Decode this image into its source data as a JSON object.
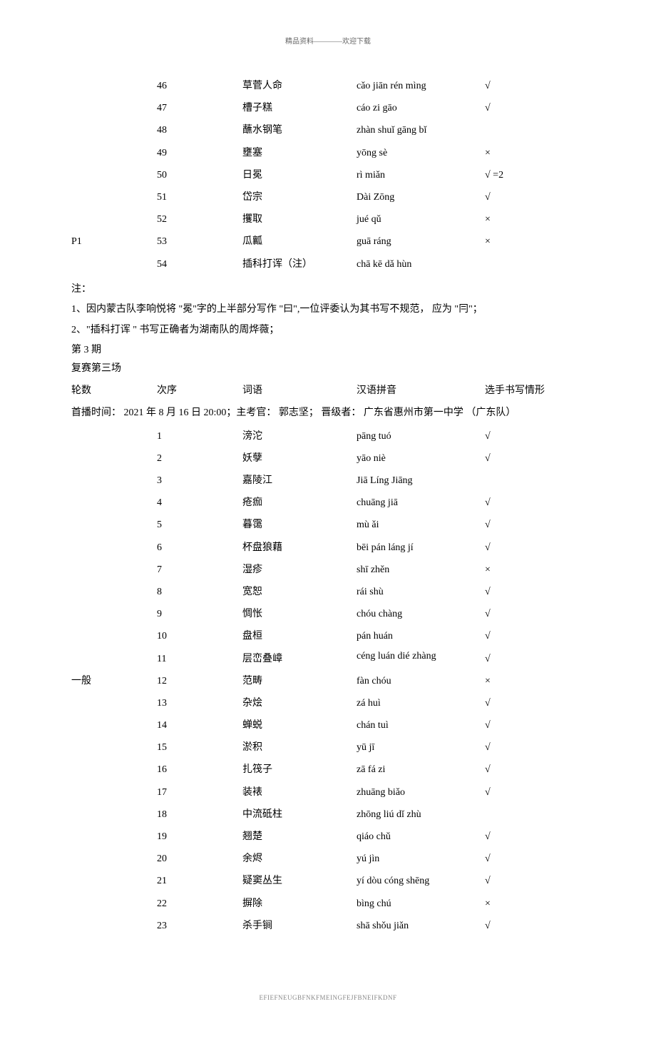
{
  "header_note": "精品资料————欢迎下载",
  "footer_code": "EFIEFNEUGBFNKFMEINGFEJFBNEIFKDNF",
  "table1": {
    "left_label": "P1",
    "rows": [
      {
        "n": "46",
        "word": "草菅人命",
        "pinyin": "cǎo jiān rén mìng",
        "result": "√"
      },
      {
        "n": "47",
        "word": "槽子糕",
        "pinyin": "cáo zi gāo",
        "result": "√"
      },
      {
        "n": "48",
        "word": "蘸水钢笔",
        "pinyin": "zhàn shuǐ gāng bǐ",
        "result": ""
      },
      {
        "n": "49",
        "word": "壅塞",
        "pinyin": "yōng sè",
        "result": "×"
      },
      {
        "n": "50",
        "word": "日冕",
        "pinyin": "rì miǎn",
        "result": "√ =2"
      },
      {
        "n": "51",
        "word": "岱宗",
        "pinyin": "Dài Zōng",
        "result": "√"
      },
      {
        "n": "52",
        "word": "攫取",
        "pinyin": "jué qǔ",
        "result": "×"
      },
      {
        "n": "53",
        "word": "瓜瓤",
        "pinyin": "guā ráng",
        "result": "×"
      },
      {
        "n": "54",
        "word": "插科打诨（注）",
        "pinyin": "chā kē dǎ hùn",
        "result": ""
      }
    ]
  },
  "notes": {
    "title": "注：",
    "lines": [
      "1、因内蒙古队李响悦将 \"冕\"字的上半部分写作 \"曰\",一位评委认为其书写不规范， 应为 \"冃\"；",
      "2、\"插科打诨 \" 书写正确者为湖南队的周烨薇；"
    ]
  },
  "episode": {
    "label": "第 3 期",
    "stage": "复赛第三场",
    "headers": {
      "round": "轮数",
      "seq": "次序",
      "word": "词语",
      "pinyin": "汉语拼音",
      "result": "选手书写情形"
    },
    "broadcast": "首播时间： 2021 年 8 月 16 日 20:00；主考官： 郭志坚； 晋级者： 广东省惠州市第一中学 （广东队）"
  },
  "table2": {
    "left_label": "一般",
    "rows": [
      {
        "n": "1",
        "word": "滂沱",
        "pinyin": "pāng tuó",
        "result": "√"
      },
      {
        "n": "2",
        "word": "妖孽",
        "pinyin": "yāo niè",
        "result": "√"
      },
      {
        "n": "3",
        "word": "嘉陵江",
        "pinyin": "Jiā Líng Jiāng",
        "result": ""
      },
      {
        "n": "4",
        "word": "疮痂",
        "pinyin": "chuāng jiā",
        "result": "√"
      },
      {
        "n": "5",
        "word": "暮霭",
        "pinyin": "mù ǎi",
        "result": "√"
      },
      {
        "n": "6",
        "word": "杯盘狼藉",
        "pinyin": "bēi pán láng jí",
        "result": "√"
      },
      {
        "n": "7",
        "word": "湿疹",
        "pinyin": "shī zhěn",
        "result": "×"
      },
      {
        "n": "8",
        "word": "宽恕",
        "pinyin": "rái shù",
        "result": "√"
      },
      {
        "n": "9",
        "word": "惆怅",
        "pinyin": "chóu chàng",
        "result": "√"
      },
      {
        "n": "10",
        "word": "盘桓",
        "pinyin": "pán huán",
        "result": "√"
      },
      {
        "n": "11",
        "word": "层峦叠嶂",
        "pinyin": "céng luán dié zhàng",
        "result": "√",
        "multiline": true
      },
      {
        "n": "12",
        "word": "范畴",
        "pinyin": "fàn chóu",
        "result": "×"
      },
      {
        "n": "13",
        "word": "杂烩",
        "pinyin": "zá huì",
        "result": "√"
      },
      {
        "n": "14",
        "word": "蝉蜕",
        "pinyin": "chán tuì",
        "result": "√"
      },
      {
        "n": "15",
        "word": "淤积",
        "pinyin": "yū jī",
        "result": "√"
      },
      {
        "n": "16",
        "word": "扎筏子",
        "pinyin": "zā fá zi",
        "result": "√"
      },
      {
        "n": "17",
        "word": "装裱",
        "pinyin": "zhuāng biǎo",
        "result": "√"
      },
      {
        "n": "18",
        "word": "中流砥柱",
        "pinyin": "zhōng liú dǐ zhù",
        "result": ""
      },
      {
        "n": "19",
        "word": "翘楚",
        "pinyin": "qiáo chǔ",
        "result": "√"
      },
      {
        "n": "20",
        "word": "余烬",
        "pinyin": "yú jìn",
        "result": "√"
      },
      {
        "n": "21",
        "word": "疑窦丛生",
        "pinyin": "yí dòu cóng shēng",
        "result": "√"
      },
      {
        "n": "22",
        "word": "摒除",
        "pinyin": "bìng chú",
        "result": "×"
      },
      {
        "n": "23",
        "word": "杀手锏",
        "pinyin": "shā shǒu jiǎn",
        "result": "√"
      }
    ]
  }
}
